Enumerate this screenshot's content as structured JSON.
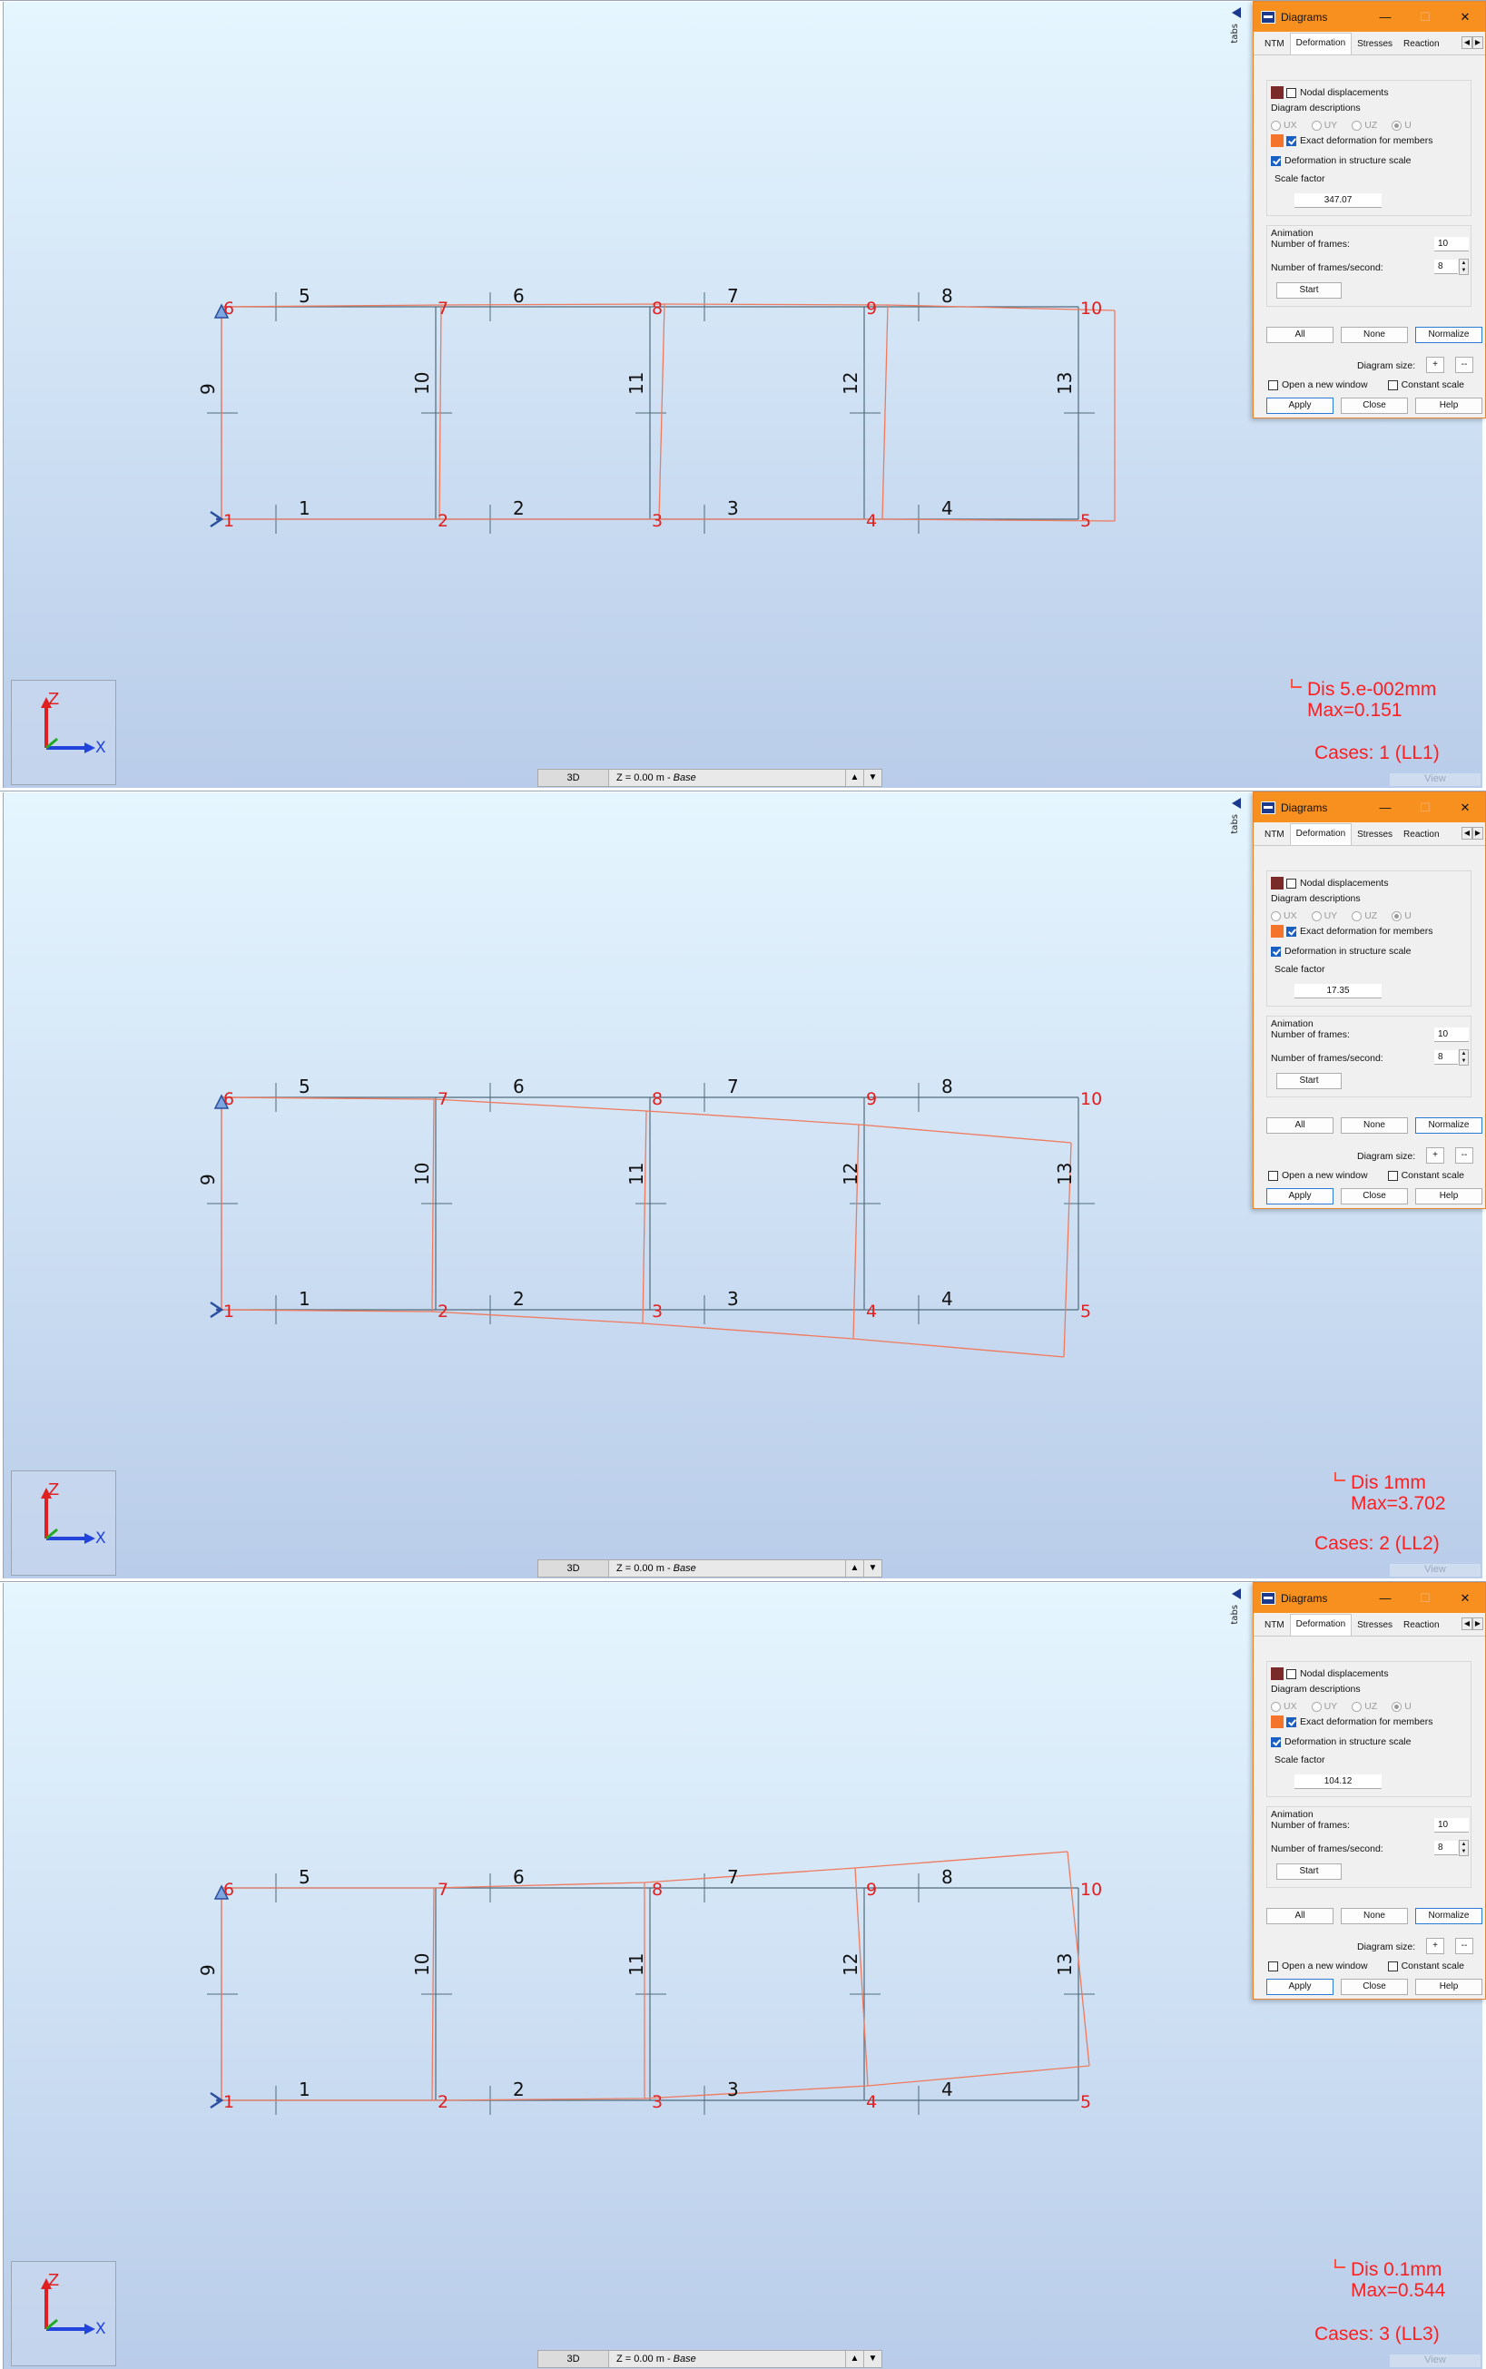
{
  "colors": {
    "accent": "#f7901e",
    "node_label": "#e02020",
    "member_label": "#111111",
    "deformed": "#f07a5c",
    "frame": "#4f6b7b"
  },
  "structure": {
    "node_labels": [
      "1",
      "2",
      "3",
      "4",
      "5",
      "6",
      "7",
      "8",
      "9",
      "10"
    ],
    "bottom_member_labels": [
      "1",
      "2",
      "3",
      "4"
    ],
    "top_member_labels": [
      "5",
      "6",
      "7",
      "8"
    ],
    "column_member_labels": [
      "9",
      "10",
      "11",
      "12",
      "13"
    ]
  },
  "dialog": {
    "title": "Diagrams",
    "tabs": [
      "NTM",
      "Deformation",
      "Stresses",
      "Reaction"
    ],
    "nodal_displacements": "Nodal displacements",
    "diagram_descriptions": "Diagram descriptions",
    "radios": [
      "UX",
      "UY",
      "UZ",
      "U"
    ],
    "exact_deformation": "Exact deformation for members",
    "deformation_scale": "Deformation in structure scale",
    "scale_factor_label": "Scale factor",
    "animation_label": "Animation",
    "frames_label": "Number of frames:",
    "frames_value": "10",
    "fps_label": "Number of frames/second:",
    "fps_value": "8",
    "start": "Start",
    "all": "All",
    "none": "None",
    "normalize": "Normalize",
    "diagram_size": "Diagram size:",
    "plus": "+",
    "minus": "--",
    "open_new_window": "Open a new window",
    "constant_scale": "Constant scale",
    "apply": "Apply",
    "close": "Close",
    "help": "Help",
    "minimize": "—",
    "maximize": "☐",
    "close_x": "✕"
  },
  "viewbar": {
    "mode": "3D",
    "level_prefix": "Z = 0.00 m - ",
    "level_name": "Base",
    "up": "▲",
    "down": "▼"
  },
  "view_tab": "View",
  "tabs_strip": "tabs",
  "axis": {
    "z": "Z",
    "x": "X"
  },
  "panels": [
    {
      "scale_factor": "347.07",
      "dis": "Dis  5.e-002mm",
      "max": "Max=0.151",
      "cases": "Cases: 1 (LL1)"
    },
    {
      "scale_factor": "17.35",
      "dis": "Dis  1mm",
      "max": "Max=3.702",
      "cases": "Cases: 2 (LL2)"
    },
    {
      "scale_factor": "104.12",
      "dis": "Dis  0.1mm",
      "max": "Max=0.544",
      "cases": "Cases: 3 (LL3)"
    }
  ]
}
